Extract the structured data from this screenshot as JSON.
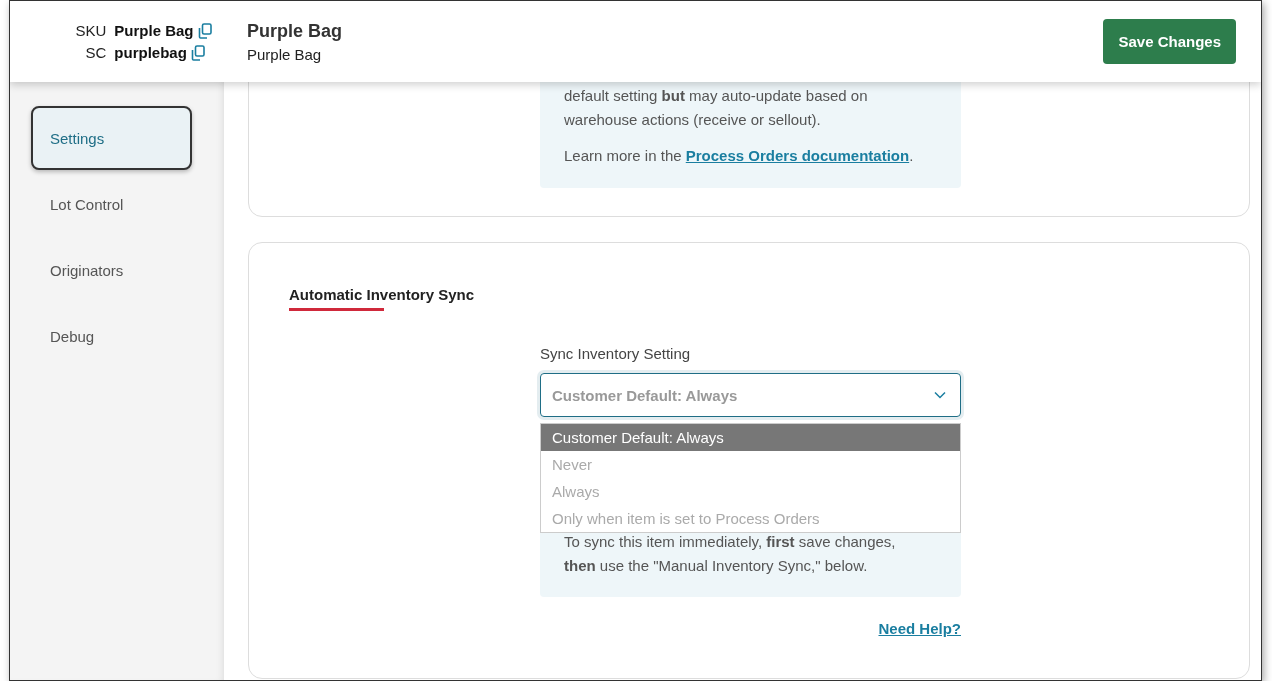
{
  "header": {
    "identifiers": [
      {
        "label": "SKU",
        "value": "Purple Bag"
      },
      {
        "label": "SC",
        "value": "purplebag"
      }
    ],
    "title": "Purple Bag",
    "subtitle": "Purple Bag",
    "save_button": "Save Changes"
  },
  "sidebar": {
    "items": [
      {
        "label": "Settings",
        "selected": true
      },
      {
        "label": "Lot Control",
        "selected": false
      },
      {
        "label": "Originators",
        "selected": false
      },
      {
        "label": "Debug",
        "selected": false
      }
    ]
  },
  "process_orders_card": {
    "info": "default setting **but** may auto-update based on warehouse actions (receive or sellout).",
    "learn_more_before": "Learn more in the",
    "learn_more_link": "Process Orders documentation",
    "learn_more_after": "."
  },
  "sync_card": {
    "title": "Automatic Inventory Sync",
    "field_label": "Sync Inventory Setting",
    "select": {
      "value": "Customer Default: Always",
      "open": true,
      "options": [
        {
          "label": "Customer Default: Always",
          "selected": true
        },
        {
          "label": "Never",
          "selected": false
        },
        {
          "label": "Always",
          "selected": false
        },
        {
          "label": "Only when item is set to Process Orders",
          "selected": false
        }
      ]
    },
    "info": "To sync this item immediately, **first** save changes, **then** use the \"Manual Inventory Sync,\" below.",
    "help_link": "Need Help?"
  }
}
